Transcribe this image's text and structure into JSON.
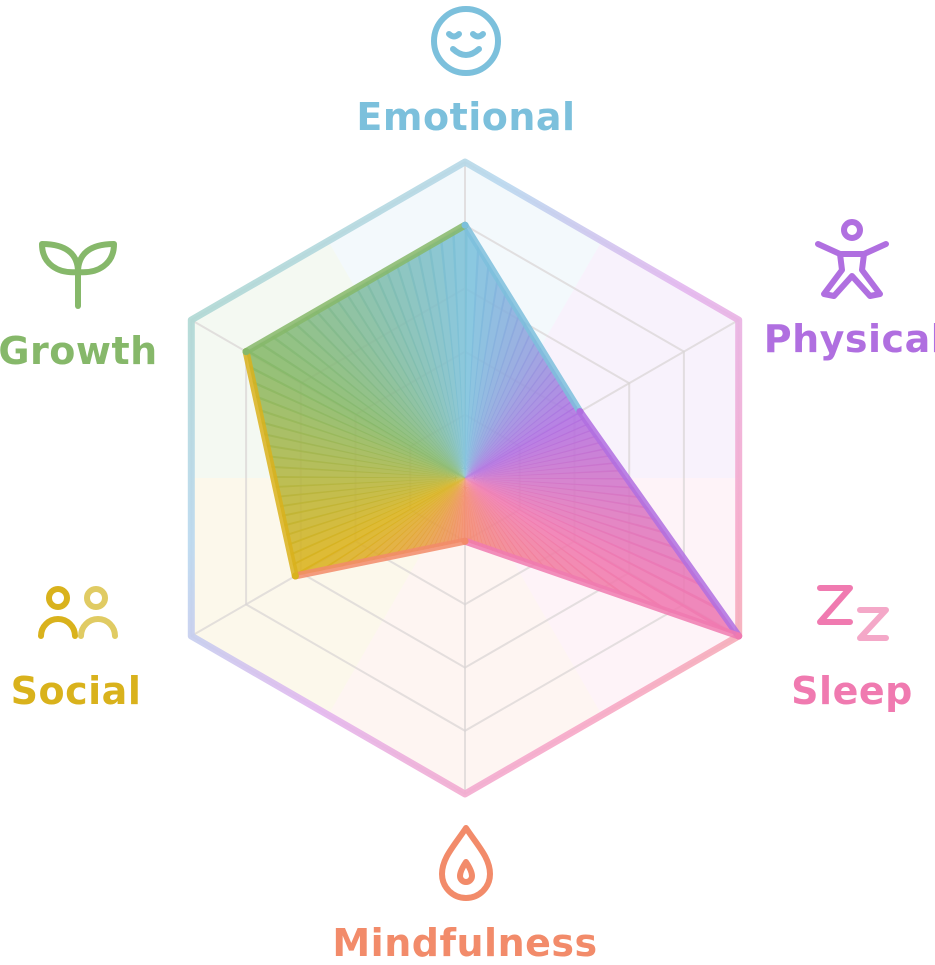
{
  "chart_data": {
    "type": "radar",
    "axes": [
      {
        "label": "Emotional",
        "icon": "smiling-face-icon",
        "color": "#7cc0dc"
      },
      {
        "label": "Physical",
        "icon": "person-stretch-icon",
        "color": "#b06fe0"
      },
      {
        "label": "Sleep",
        "icon": "zz-sleep-icon",
        "color": "#f07ab0"
      },
      {
        "label": "Mindfulness",
        "icon": "drop-icon",
        "color": "#f28b6a"
      },
      {
        "label": "Social",
        "icon": "people-icon",
        "color": "#d9b21c"
      },
      {
        "label": "Growth",
        "icon": "sprout-icon",
        "color": "#86b86a"
      }
    ],
    "values": [
      0.8,
      0.42,
      1.0,
      0.2,
      0.62,
      0.8
    ],
    "range": [
      0,
      1
    ],
    "rings": 5,
    "grid": true
  }
}
